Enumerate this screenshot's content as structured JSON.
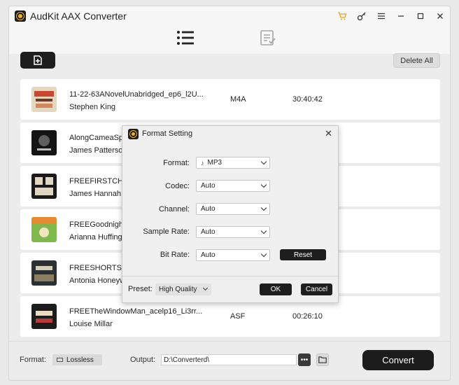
{
  "app": {
    "title": "AudKit AAX Converter"
  },
  "titlebar_icons": [
    "cart-icon",
    "key-icon",
    "menu-icon",
    "minimize-icon",
    "maximize-icon",
    "close-icon"
  ],
  "toolbar": {
    "delete_all_label": "Delete All"
  },
  "files": [
    {
      "name": "11-22-63ANovelUnabridged_ep6_l2U...",
      "author": "Stephen King",
      "format": "M4A",
      "duration": "30:40:42",
      "cover_colors": [
        "#c9482f",
        "#e6d8c0"
      ]
    },
    {
      "name": "AlongCameaSpi",
      "author": "James Patterson",
      "format": "",
      "duration": "",
      "cover_colors": [
        "#141414",
        "#5e5e5e"
      ]
    },
    {
      "name": "FREEFIRSTCHAI",
      "author": "James Hannah",
      "format": "",
      "duration": "",
      "cover_colors": [
        "#1a1a1a",
        "#e0d6c2"
      ]
    },
    {
      "name": "FREEGoodnightS",
      "author": "Arianna Huffington",
      "format": "",
      "duration": "",
      "cover_colors": [
        "#7fb84b",
        "#e78a2e"
      ]
    },
    {
      "name": "FREESHORTSTO",
      "author": "Antonia Honeywell",
      "format": "",
      "duration": "",
      "cover_colors": [
        "#2c2f33",
        "#d7cdb5"
      ]
    },
    {
      "name": "FREETheWindowMan_acelp16_Li3rr...",
      "author": "Louise Millar",
      "format": "ASF",
      "duration": "00:26:10",
      "cover_colors": [
        "#1c1c1c",
        "#b73b3b"
      ]
    }
  ],
  "bottom": {
    "format_label": "Format:",
    "format_value": "Lossless",
    "output_label": "Output:",
    "output_path": "D:\\Converterd\\",
    "browse_label": "•••",
    "convert_label": "Convert"
  },
  "dialog": {
    "title": "Format Setting",
    "fields": [
      {
        "label": "Format:",
        "value": "MP3"
      },
      {
        "label": "Codec:",
        "value": "Auto"
      },
      {
        "label": "Channel:",
        "value": "Auto"
      },
      {
        "label": "Sample Rate:",
        "value": "Auto"
      },
      {
        "label": "Bit Rate:",
        "value": "Auto"
      }
    ],
    "reset_label": "Reset",
    "preset_label": "Preset:",
    "preset_value": "High Quality",
    "ok_label": "OK",
    "cancel_label": "Cancel"
  },
  "colors": {
    "accent": "#f3b11f",
    "dark": "#1b1b1b"
  }
}
